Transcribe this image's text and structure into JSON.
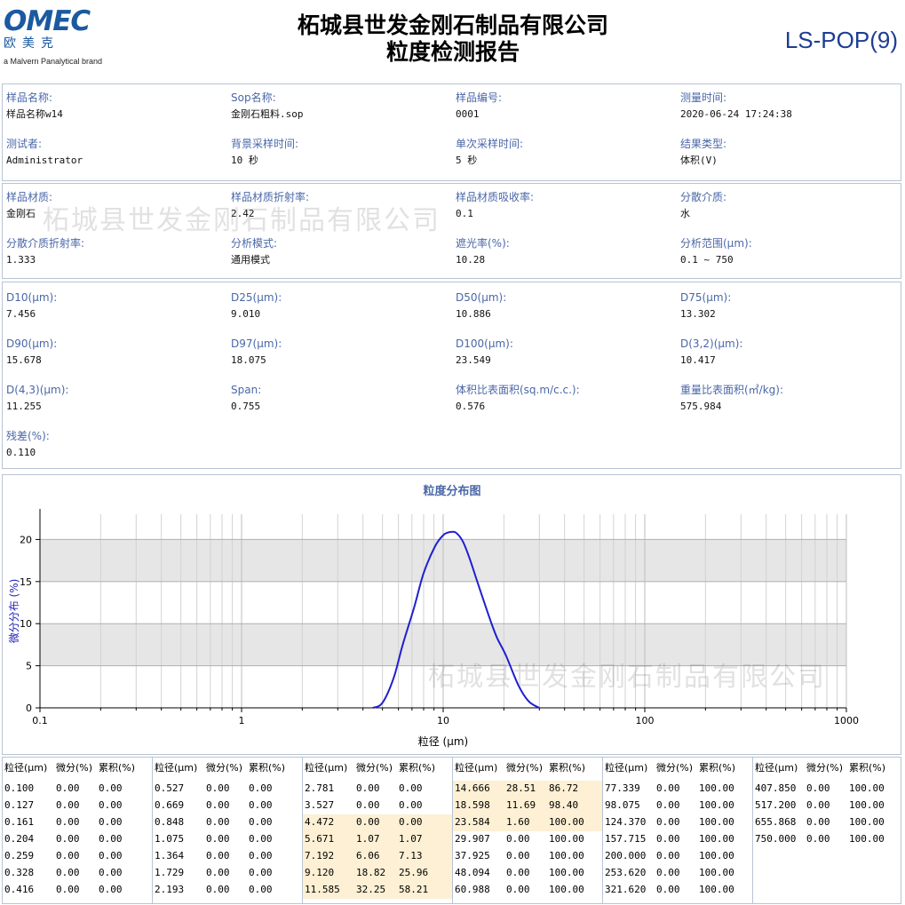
{
  "header": {
    "logo_text": "OMEC",
    "logo_cn": "欧美克",
    "logo_sub": "a Malvern Panalytical brand",
    "title_line1": "柘城县世发金刚石制品有限公司",
    "title_line2": "粒度检测报告",
    "report_code": "LS-POP(9)"
  },
  "watermark": "柘城县世发金刚石制品有限公司",
  "sample_info": [
    {
      "label": "样品名称:",
      "value": "样品名称w14"
    },
    {
      "label": "Sop名称:",
      "value": "金刚石粗料.sop"
    },
    {
      "label": "样品编号:",
      "value": "0001"
    },
    {
      "label": "测量时间:",
      "value": "2020-06-24 17:24:38"
    },
    {
      "label": "测试者:",
      "value": "Administrator"
    },
    {
      "label": "背景采样时间:",
      "value": "10 秒"
    },
    {
      "label": "单次采样时间:",
      "value": "5 秒"
    },
    {
      "label": "结果类型:",
      "value": "体积(V)"
    }
  ],
  "material_info": [
    {
      "label": "样品材质:",
      "value": "金刚石"
    },
    {
      "label": "样品材质折射率:",
      "value": "2.42"
    },
    {
      "label": "样品材质吸收率:",
      "value": "0.1"
    },
    {
      "label": "分散介质:",
      "value": "水"
    },
    {
      "label": "分散介质折射率:",
      "value": "1.333"
    },
    {
      "label": "分析模式:",
      "value": "通用模式"
    },
    {
      "label": "遮光率(%):",
      "value": "10.28"
    },
    {
      "label": "分析范围(μm):",
      "value": "0.1 ~ 750"
    }
  ],
  "results": [
    {
      "label": "D10(μm):",
      "value": "7.456"
    },
    {
      "label": "D25(μm):",
      "value": "9.010"
    },
    {
      "label": "D50(μm):",
      "value": "10.886"
    },
    {
      "label": "D75(μm):",
      "value": "13.302"
    },
    {
      "label": "D90(μm):",
      "value": "15.678"
    },
    {
      "label": "D97(μm):",
      "value": "18.075"
    },
    {
      "label": "D100(μm):",
      "value": "23.549"
    },
    {
      "label": "D(3,2)(μm):",
      "value": "10.417"
    },
    {
      "label": "D(4,3)(μm):",
      "value": "11.255"
    },
    {
      "label": "Span:",
      "value": "0.755"
    },
    {
      "label": "体积比表面积(sq.m/c.c.):",
      "value": "0.576"
    },
    {
      "label": "重量比表面积(㎡/kg):",
      "value": "575.984"
    },
    {
      "label": "残差(%):",
      "value": "0.110"
    }
  ],
  "chart_data": {
    "type": "line",
    "title": "粒度分布图",
    "xlabel": "粒径 (μm)",
    "ylabel": "微分分布 (%)",
    "x_scale": "log",
    "xlim": [
      0.1,
      1000
    ],
    "ylim": [
      0,
      23
    ],
    "x_ticks": [
      "0.1",
      "1",
      "10",
      "100",
      "1000"
    ],
    "y_ticks": [
      "0",
      "5",
      "10",
      "15",
      "20"
    ],
    "grid": true,
    "line_color": "#1f1fd0",
    "band_color": "#e6e6e6",
    "series": [
      {
        "x": [
          4.472,
          5.0,
          5.671,
          6.3,
          7.192,
          8.0,
          9.12,
          10.0,
          10.5,
          11.0,
          11.585,
          12.5,
          13.5,
          14.666,
          16.0,
          17.5,
          18.598,
          20.5,
          23.584,
          26.5,
          29.907
        ],
        "y": [
          0.0,
          0.6,
          3.5,
          7.5,
          12.0,
          16.0,
          19.2,
          20.5,
          20.8,
          20.9,
          20.8,
          19.8,
          17.8,
          15.2,
          12.5,
          9.8,
          8.2,
          6.2,
          2.7,
          0.8,
          0.0
        ]
      }
    ]
  },
  "table": {
    "headers": [
      "粒径(μm)",
      "微分(%)",
      "累积(%)"
    ],
    "blocks": [
      {
        "rows": [
          [
            "0.100",
            "0.00",
            "0.00"
          ],
          [
            "0.127",
            "0.00",
            "0.00"
          ],
          [
            "0.161",
            "0.00",
            "0.00"
          ],
          [
            "0.204",
            "0.00",
            "0.00"
          ],
          [
            "0.259",
            "0.00",
            "0.00"
          ],
          [
            "0.328",
            "0.00",
            "0.00"
          ],
          [
            "0.416",
            "0.00",
            "0.00"
          ]
        ]
      },
      {
        "rows": [
          [
            "0.527",
            "0.00",
            "0.00"
          ],
          [
            "0.669",
            "0.00",
            "0.00"
          ],
          [
            "0.848",
            "0.00",
            "0.00"
          ],
          [
            "1.075",
            "0.00",
            "0.00"
          ],
          [
            "1.364",
            "0.00",
            "0.00"
          ],
          [
            "1.729",
            "0.00",
            "0.00"
          ],
          [
            "2.193",
            "0.00",
            "0.00"
          ]
        ]
      },
      {
        "rows": [
          [
            "2.781",
            "0.00",
            "0.00"
          ],
          [
            "3.527",
            "0.00",
            "0.00"
          ],
          [
            "4.472",
            "0.00",
            "0.00"
          ],
          [
            "5.671",
            "1.07",
            "1.07"
          ],
          [
            "7.192",
            "6.06",
            "7.13"
          ],
          [
            "9.120",
            "18.82",
            "25.96"
          ],
          [
            "11.585",
            "32.25",
            "58.21"
          ]
        ],
        "highlight": [
          2,
          3,
          4,
          5,
          6
        ]
      },
      {
        "rows": [
          [
            "14.666",
            "28.51",
            "86.72"
          ],
          [
            "18.598",
            "11.69",
            "98.40"
          ],
          [
            "23.584",
            "1.60",
            "100.00"
          ],
          [
            "29.907",
            "0.00",
            "100.00"
          ],
          [
            "37.925",
            "0.00",
            "100.00"
          ],
          [
            "48.094",
            "0.00",
            "100.00"
          ],
          [
            "60.988",
            "0.00",
            "100.00"
          ]
        ],
        "highlight": [
          0,
          1,
          2
        ]
      },
      {
        "rows": [
          [
            "77.339",
            "0.00",
            "100.00"
          ],
          [
            "98.075",
            "0.00",
            "100.00"
          ],
          [
            "124.370",
            "0.00",
            "100.00"
          ],
          [
            "157.715",
            "0.00",
            "100.00"
          ],
          [
            "200.000",
            "0.00",
            "100.00"
          ],
          [
            "253.620",
            "0.00",
            "100.00"
          ],
          [
            "321.620",
            "0.00",
            "100.00"
          ]
        ]
      },
      {
        "rows": [
          [
            "407.850",
            "0.00",
            "100.00"
          ],
          [
            "517.200",
            "0.00",
            "100.00"
          ],
          [
            "655.868",
            "0.00",
            "100.00"
          ],
          [
            "750.000",
            "0.00",
            "100.00"
          ]
        ]
      }
    ]
  }
}
